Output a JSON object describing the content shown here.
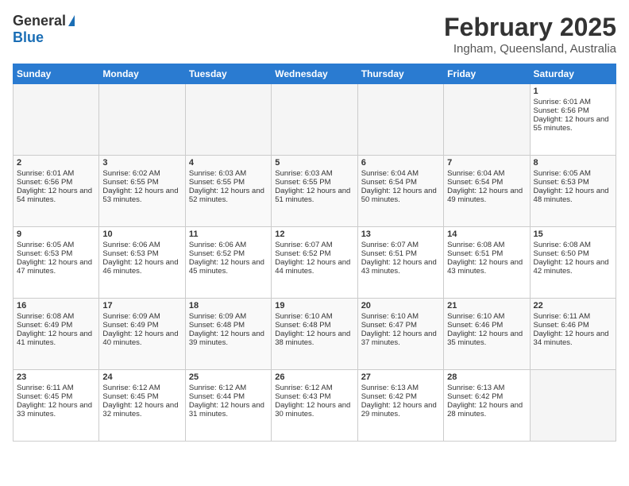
{
  "header": {
    "logo_general": "General",
    "logo_blue": "Blue",
    "month_title": "February 2025",
    "location": "Ingham, Queensland, Australia"
  },
  "days_of_week": [
    "Sunday",
    "Monday",
    "Tuesday",
    "Wednesday",
    "Thursday",
    "Friday",
    "Saturday"
  ],
  "weeks": [
    [
      {
        "day": "",
        "sunrise": "",
        "sunset": "",
        "daylight": "",
        "empty": true
      },
      {
        "day": "",
        "sunrise": "",
        "sunset": "",
        "daylight": "",
        "empty": true
      },
      {
        "day": "",
        "sunrise": "",
        "sunset": "",
        "daylight": "",
        "empty": true
      },
      {
        "day": "",
        "sunrise": "",
        "sunset": "",
        "daylight": "",
        "empty": true
      },
      {
        "day": "",
        "sunrise": "",
        "sunset": "",
        "daylight": "",
        "empty": true
      },
      {
        "day": "",
        "sunrise": "",
        "sunset": "",
        "daylight": "",
        "empty": true
      },
      {
        "day": "1",
        "sunrise": "Sunrise: 6:01 AM",
        "sunset": "Sunset: 6:56 PM",
        "daylight": "Daylight: 12 hours and 55 minutes.",
        "empty": false
      }
    ],
    [
      {
        "day": "2",
        "sunrise": "Sunrise: 6:01 AM",
        "sunset": "Sunset: 6:56 PM",
        "daylight": "Daylight: 12 hours and 54 minutes.",
        "empty": false
      },
      {
        "day": "3",
        "sunrise": "Sunrise: 6:02 AM",
        "sunset": "Sunset: 6:55 PM",
        "daylight": "Daylight: 12 hours and 53 minutes.",
        "empty": false
      },
      {
        "day": "4",
        "sunrise": "Sunrise: 6:03 AM",
        "sunset": "Sunset: 6:55 PM",
        "daylight": "Daylight: 12 hours and 52 minutes.",
        "empty": false
      },
      {
        "day": "5",
        "sunrise": "Sunrise: 6:03 AM",
        "sunset": "Sunset: 6:55 PM",
        "daylight": "Daylight: 12 hours and 51 minutes.",
        "empty": false
      },
      {
        "day": "6",
        "sunrise": "Sunrise: 6:04 AM",
        "sunset": "Sunset: 6:54 PM",
        "daylight": "Daylight: 12 hours and 50 minutes.",
        "empty": false
      },
      {
        "day": "7",
        "sunrise": "Sunrise: 6:04 AM",
        "sunset": "Sunset: 6:54 PM",
        "daylight": "Daylight: 12 hours and 49 minutes.",
        "empty": false
      },
      {
        "day": "8",
        "sunrise": "Sunrise: 6:05 AM",
        "sunset": "Sunset: 6:53 PM",
        "daylight": "Daylight: 12 hours and 48 minutes.",
        "empty": false
      }
    ],
    [
      {
        "day": "9",
        "sunrise": "Sunrise: 6:05 AM",
        "sunset": "Sunset: 6:53 PM",
        "daylight": "Daylight: 12 hours and 47 minutes.",
        "empty": false
      },
      {
        "day": "10",
        "sunrise": "Sunrise: 6:06 AM",
        "sunset": "Sunset: 6:53 PM",
        "daylight": "Daylight: 12 hours and 46 minutes.",
        "empty": false
      },
      {
        "day": "11",
        "sunrise": "Sunrise: 6:06 AM",
        "sunset": "Sunset: 6:52 PM",
        "daylight": "Daylight: 12 hours and 45 minutes.",
        "empty": false
      },
      {
        "day": "12",
        "sunrise": "Sunrise: 6:07 AM",
        "sunset": "Sunset: 6:52 PM",
        "daylight": "Daylight: 12 hours and 44 minutes.",
        "empty": false
      },
      {
        "day": "13",
        "sunrise": "Sunrise: 6:07 AM",
        "sunset": "Sunset: 6:51 PM",
        "daylight": "Daylight: 12 hours and 43 minutes.",
        "empty": false
      },
      {
        "day": "14",
        "sunrise": "Sunrise: 6:08 AM",
        "sunset": "Sunset: 6:51 PM",
        "daylight": "Daylight: 12 hours and 43 minutes.",
        "empty": false
      },
      {
        "day": "15",
        "sunrise": "Sunrise: 6:08 AM",
        "sunset": "Sunset: 6:50 PM",
        "daylight": "Daylight: 12 hours and 42 minutes.",
        "empty": false
      }
    ],
    [
      {
        "day": "16",
        "sunrise": "Sunrise: 6:08 AM",
        "sunset": "Sunset: 6:49 PM",
        "daylight": "Daylight: 12 hours and 41 minutes.",
        "empty": false
      },
      {
        "day": "17",
        "sunrise": "Sunrise: 6:09 AM",
        "sunset": "Sunset: 6:49 PM",
        "daylight": "Daylight: 12 hours and 40 minutes.",
        "empty": false
      },
      {
        "day": "18",
        "sunrise": "Sunrise: 6:09 AM",
        "sunset": "Sunset: 6:48 PM",
        "daylight": "Daylight: 12 hours and 39 minutes.",
        "empty": false
      },
      {
        "day": "19",
        "sunrise": "Sunrise: 6:10 AM",
        "sunset": "Sunset: 6:48 PM",
        "daylight": "Daylight: 12 hours and 38 minutes.",
        "empty": false
      },
      {
        "day": "20",
        "sunrise": "Sunrise: 6:10 AM",
        "sunset": "Sunset: 6:47 PM",
        "daylight": "Daylight: 12 hours and 37 minutes.",
        "empty": false
      },
      {
        "day": "21",
        "sunrise": "Sunrise: 6:10 AM",
        "sunset": "Sunset: 6:46 PM",
        "daylight": "Daylight: 12 hours and 35 minutes.",
        "empty": false
      },
      {
        "day": "22",
        "sunrise": "Sunrise: 6:11 AM",
        "sunset": "Sunset: 6:46 PM",
        "daylight": "Daylight: 12 hours and 34 minutes.",
        "empty": false
      }
    ],
    [
      {
        "day": "23",
        "sunrise": "Sunrise: 6:11 AM",
        "sunset": "Sunset: 6:45 PM",
        "daylight": "Daylight: 12 hours and 33 minutes.",
        "empty": false
      },
      {
        "day": "24",
        "sunrise": "Sunrise: 6:12 AM",
        "sunset": "Sunset: 6:45 PM",
        "daylight": "Daylight: 12 hours and 32 minutes.",
        "empty": false
      },
      {
        "day": "25",
        "sunrise": "Sunrise: 6:12 AM",
        "sunset": "Sunset: 6:44 PM",
        "daylight": "Daylight: 12 hours and 31 minutes.",
        "empty": false
      },
      {
        "day": "26",
        "sunrise": "Sunrise: 6:12 AM",
        "sunset": "Sunset: 6:43 PM",
        "daylight": "Daylight: 12 hours and 30 minutes.",
        "empty": false
      },
      {
        "day": "27",
        "sunrise": "Sunrise: 6:13 AM",
        "sunset": "Sunset: 6:42 PM",
        "daylight": "Daylight: 12 hours and 29 minutes.",
        "empty": false
      },
      {
        "day": "28",
        "sunrise": "Sunrise: 6:13 AM",
        "sunset": "Sunset: 6:42 PM",
        "daylight": "Daylight: 12 hours and 28 minutes.",
        "empty": false
      },
      {
        "day": "",
        "sunrise": "",
        "sunset": "",
        "daylight": "",
        "empty": true
      }
    ]
  ]
}
